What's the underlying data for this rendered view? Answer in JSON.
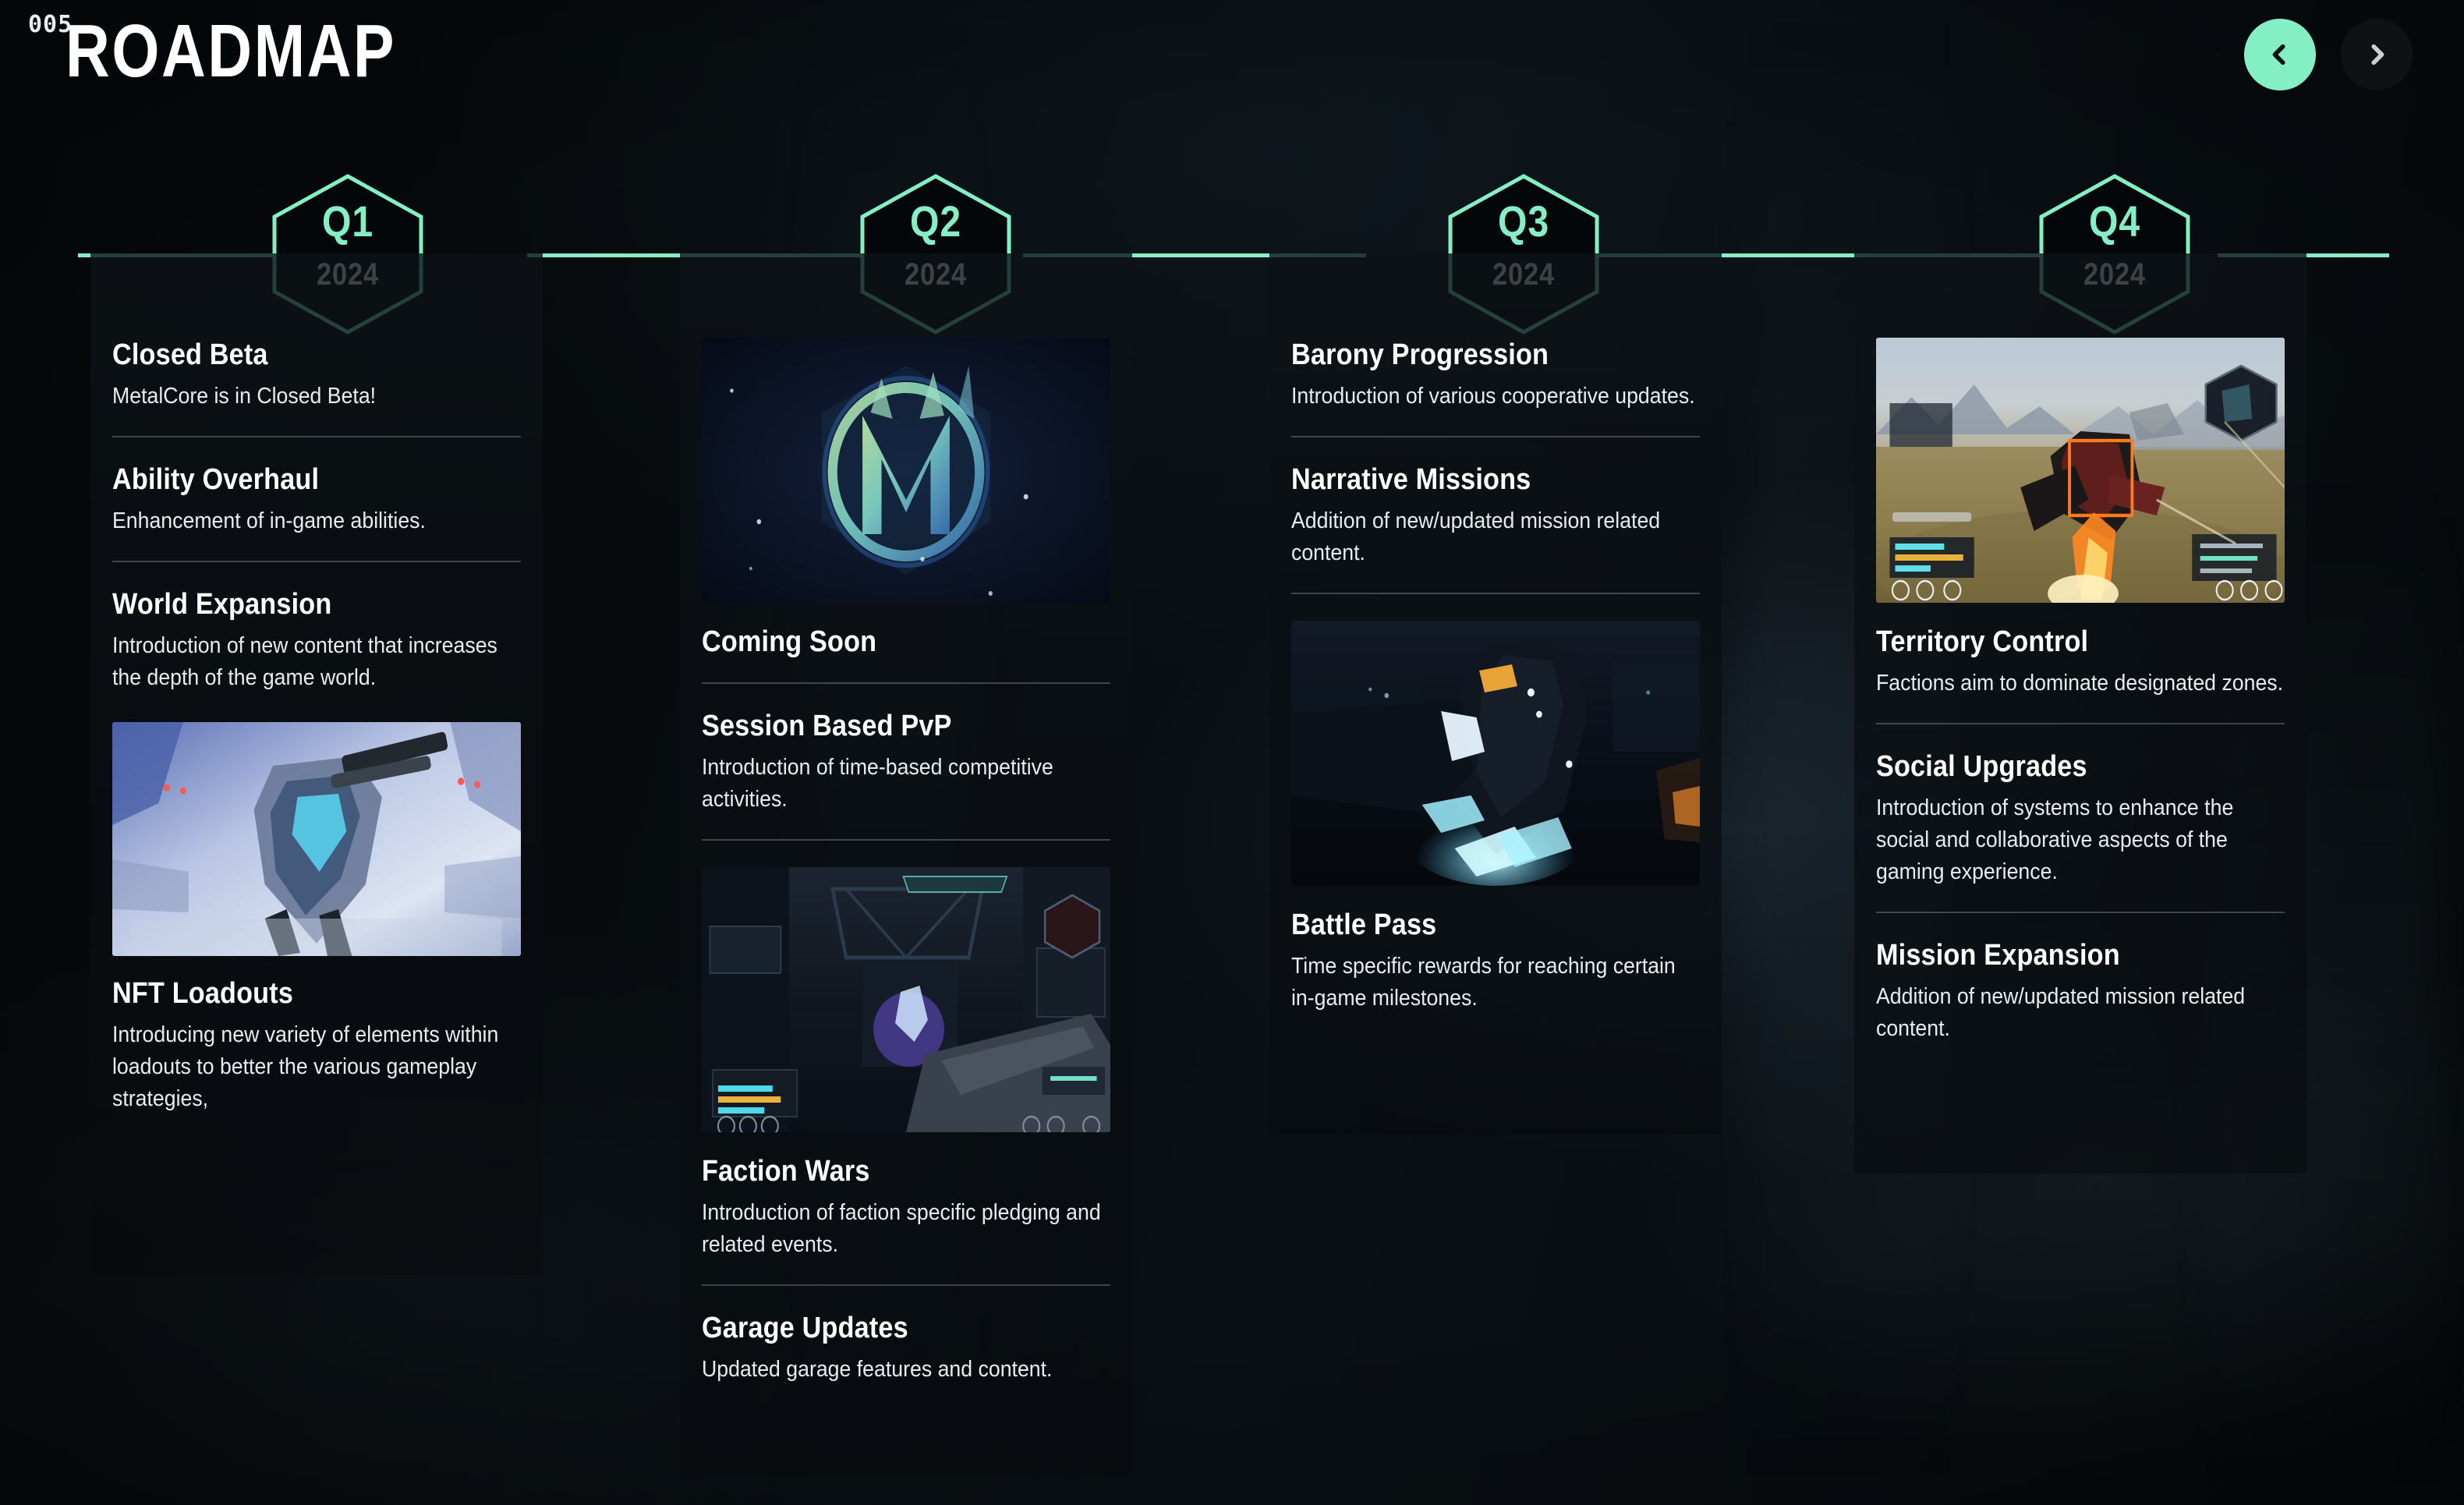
{
  "header": {
    "number": "005",
    "title": "ROADMAP",
    "prev_icon": "chevron-left-icon",
    "next_icon": "chevron-right-icon",
    "accent_color": "#84EFC4",
    "prev_active": true
  },
  "timeline": {
    "line_color": "#84EFC4",
    "markers": [
      {
        "quarter": "Q1",
        "year": "2024"
      },
      {
        "quarter": "Q2",
        "year": "2024"
      },
      {
        "quarter": "Q3",
        "year": "2024"
      },
      {
        "quarter": "Q4",
        "year": "2024"
      }
    ]
  },
  "columns": [
    {
      "quarter": "Q1",
      "items": [
        {
          "title": "Closed Beta",
          "desc": "MetalCore is in Closed Beta!"
        },
        {
          "title": "Ability Overhaul",
          "desc": "Enhancement of in-game abilities."
        },
        {
          "title": "World Expansion",
          "desc": "Introduction of new content that increases the depth of the game world."
        },
        {
          "image": "mech-hangar-blue",
          "title": "NFT Loadouts",
          "desc": "Introducing new variety of elements within loadouts to better the various gameplay strategies,"
        }
      ]
    },
    {
      "quarter": "Q2",
      "items": [
        {
          "image": "metalcore-logo-hex",
          "title": "Coming Soon",
          "desc": ""
        },
        {
          "title": "Session Based PvP",
          "desc": "Introduction of time-based competitive activities."
        },
        {
          "image": "fps-interior-gameplay",
          "title": "Faction Wars",
          "desc": "Introduction of faction specific pledging and related events."
        },
        {
          "title": "Garage Updates",
          "desc": "Updated garage features and content."
        }
      ]
    },
    {
      "quarter": "Q3",
      "items": [
        {
          "title": "Barony Progression",
          "desc": "Introduction of various cooperative updates."
        },
        {
          "title": "Narrative Missions",
          "desc": "Addition of new/updated mission related content."
        },
        {
          "image": "night-mech-city",
          "title": "Battle Pass",
          "desc": "Time specific rewards for reaching certain in-game milestones."
        }
      ]
    },
    {
      "quarter": "Q4",
      "items": [
        {
          "image": "desert-battle-hud",
          "title": "Territory Control",
          "desc": "Factions aim to dominate designated zones."
        },
        {
          "title": "Social Upgrades",
          "desc": "Introduction of systems to enhance the social and collaborative aspects of the gaming experience."
        },
        {
          "title": "Mission Expansion",
          "desc": "Addition of new/updated mission related content."
        }
      ]
    }
  ]
}
